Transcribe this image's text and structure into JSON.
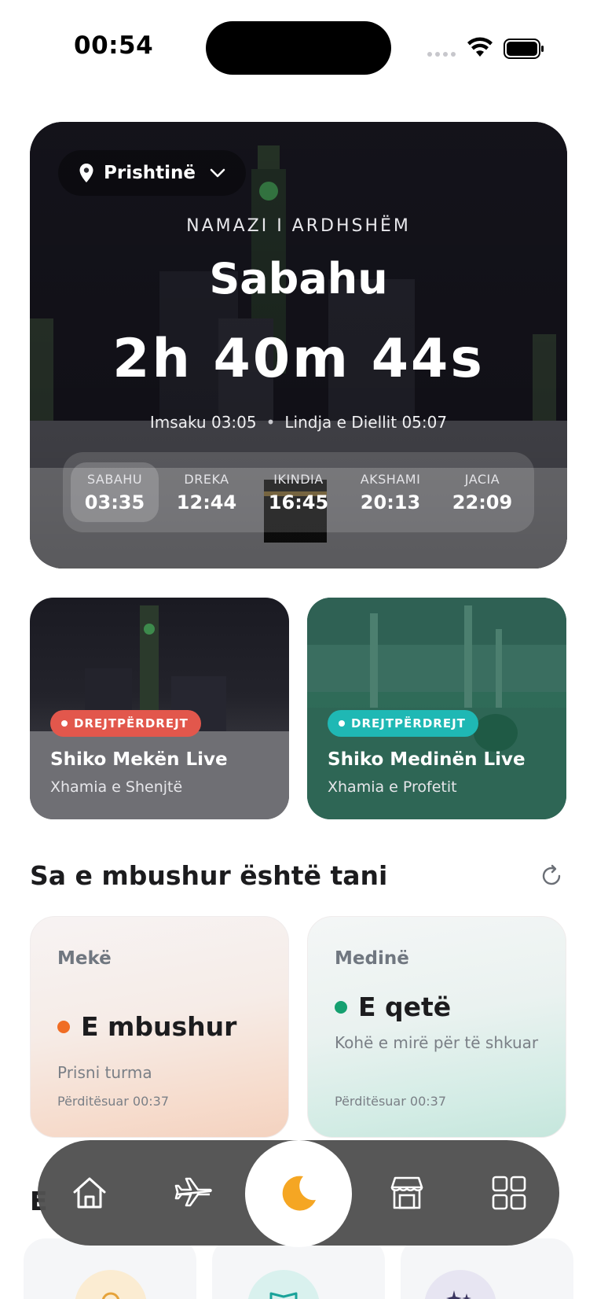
{
  "status_bar": {
    "time": "00:54",
    "icons": [
      "signal-icon",
      "wifi-icon",
      "battery-icon"
    ]
  },
  "hero": {
    "location": "Prishtinë",
    "next_label": "NAMAZI I ARDHSHËM",
    "next_prayer": "Sabahu",
    "countdown": "2h 40m 44s",
    "imsak": "Imsaku 03:05",
    "sunrise": "Lindja e Diellit 05:07",
    "separator": "•",
    "prayers": [
      {
        "name": "SABAHU",
        "time": "03:35",
        "active": true
      },
      {
        "name": "DREKA",
        "time": "12:44",
        "active": false
      },
      {
        "name": "IKINDIA",
        "time": "16:45",
        "active": false
      },
      {
        "name": "AKSHAMI",
        "time": "20:13",
        "active": false
      },
      {
        "name": "JACIA",
        "time": "22:09",
        "active": false
      }
    ]
  },
  "live": {
    "mecca": {
      "badge": "DREJTPËRDREJT",
      "title": "Shiko Mekën Live",
      "subtitle": "Xhamia e Shenjtë"
    },
    "medina": {
      "badge": "DREJTPËRDREJT",
      "title": "Shiko Medinën Live",
      "subtitle": "Xhamia e Profetit"
    }
  },
  "crowd": {
    "title": "Sa e mbushur është tani",
    "mecca": {
      "city": "Mekë",
      "status": "E mbushur",
      "description": "Prisni turma",
      "updated": "Përditësuar 00:37",
      "color": "#f06d24"
    },
    "medina": {
      "city": "Medinë",
      "status": "E qetë",
      "description": "Kohë e mirë për të shkuar",
      "updated": "Përditësuar 00:37",
      "color": "#15a070"
    }
  },
  "next_section_peek": "E",
  "nav": {
    "items": [
      "home-icon",
      "plane-icon",
      "moon-icon",
      "store-icon",
      "grid-icon"
    ],
    "active": "moon-icon",
    "accent": "#f5a623"
  }
}
